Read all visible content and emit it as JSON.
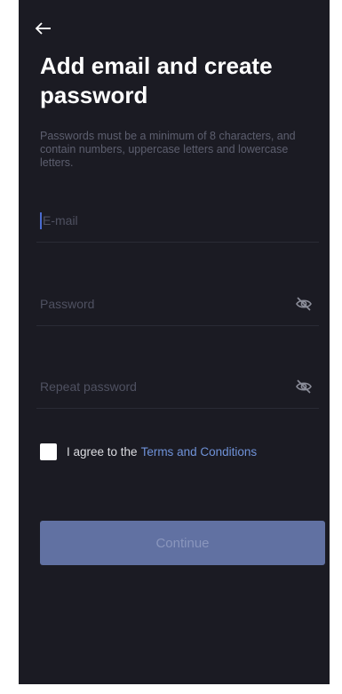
{
  "header": {
    "back_icon": "arrow-left-icon",
    "title": "Add email and create password",
    "subtitle": "Passwords must be a minimum of 8 characters, and contain numbers, uppercase letters and lowercase letters."
  },
  "form": {
    "email": {
      "placeholder": "E-mail",
      "value": ""
    },
    "password": {
      "placeholder": "Password",
      "value": "",
      "toggle_icon": "eye-off-icon"
    },
    "repeat_password": {
      "placeholder": "Repeat password",
      "value": "",
      "toggle_icon": "eye-off-icon"
    }
  },
  "agreement": {
    "text": "I agree to the",
    "link": "Terms and Conditions",
    "checked": false
  },
  "actions": {
    "continue_label": "Continue"
  },
  "colors": {
    "background": "#1b1b23",
    "link": "#6f92d8",
    "button": "#6171a2",
    "caret": "#4a6bd0"
  }
}
